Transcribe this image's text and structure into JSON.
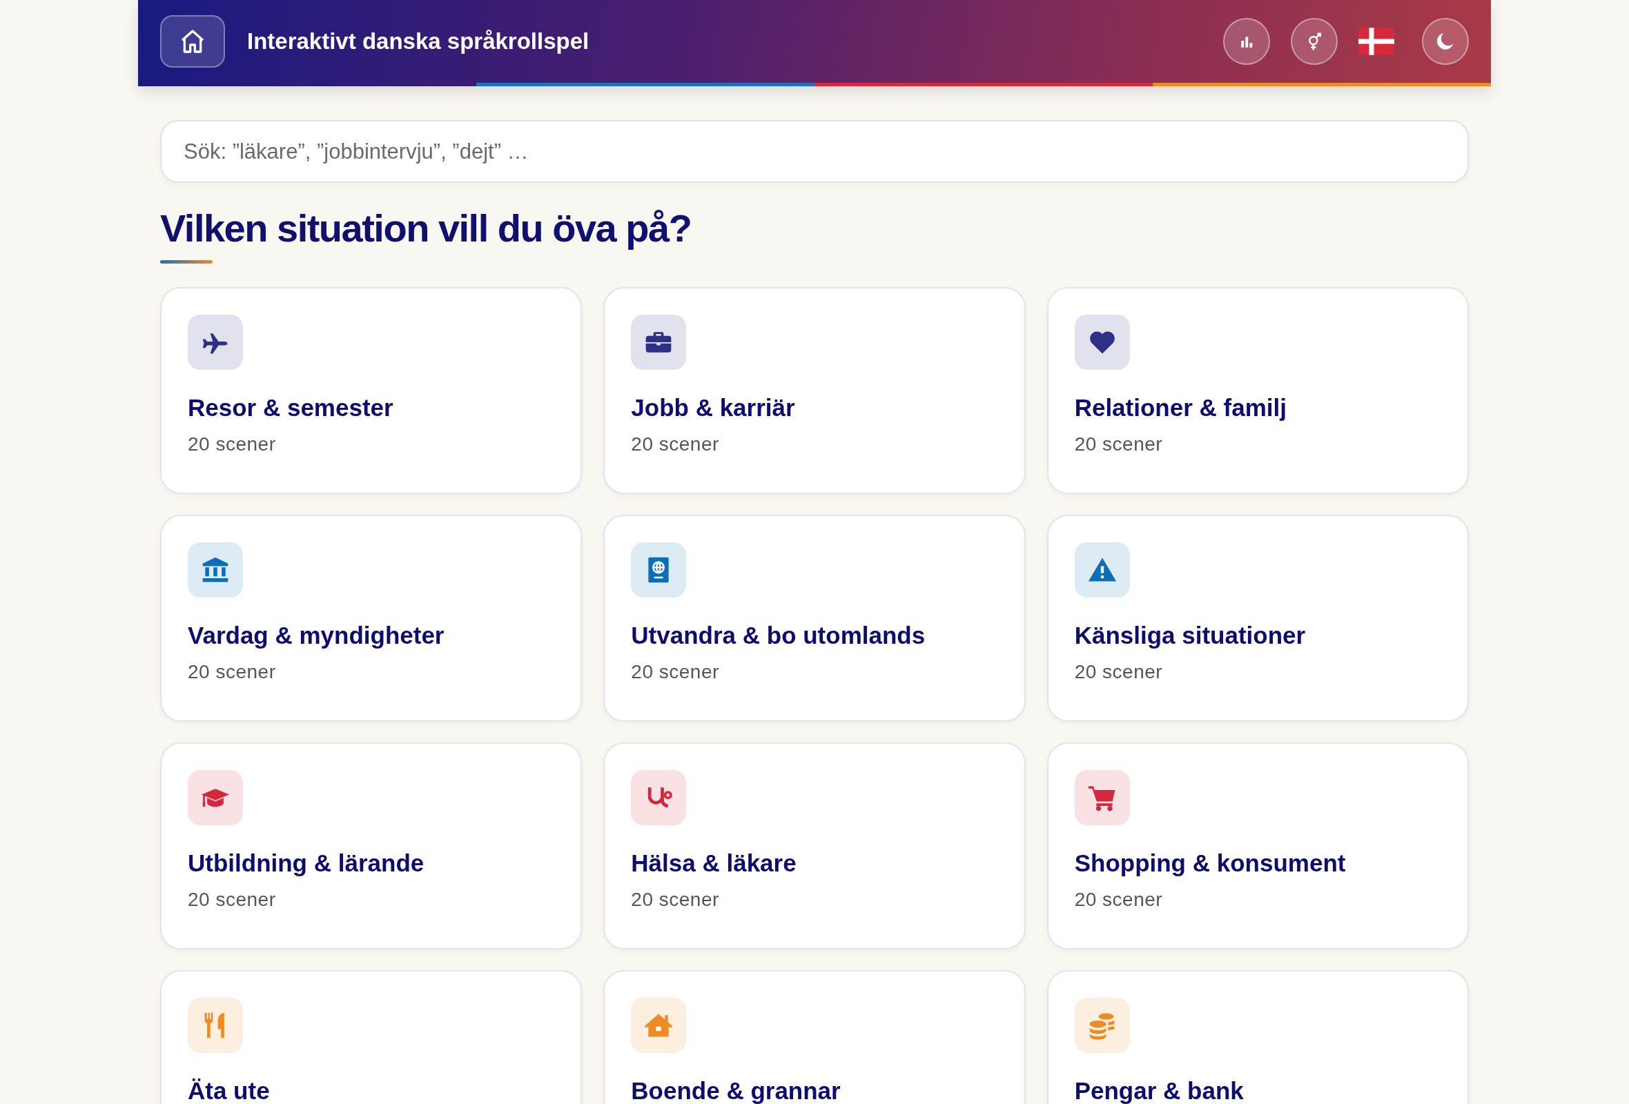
{
  "header": {
    "title": "Interaktivt danska språkrollspel"
  },
  "search": {
    "placeholder": "Sök: ”läkare”, ”jobbintervju”, ”dejt” …"
  },
  "heading": "Vilken situation vill du öva på?",
  "categories": [
    {
      "title": "Resor & semester",
      "count": "20 scener",
      "color": "#2e2f86"
    },
    {
      "title": "Jobb & karriär",
      "count": "20 scener",
      "color": "#2e2f86"
    },
    {
      "title": "Relationer & familj",
      "count": "20 scener",
      "color": "#2e2f86"
    },
    {
      "title": "Vardag & myndigheter",
      "count": "20 scener",
      "color": "#0b6fb8"
    },
    {
      "title": "Utvandra & bo utomlands",
      "count": "20 scener",
      "color": "#0b6fb8"
    },
    {
      "title": "Känsliga situationer",
      "count": "20 scener",
      "color": "#0b6fb8"
    },
    {
      "title": "Utbildning & lärande",
      "count": "20 scener",
      "color": "#d4283c"
    },
    {
      "title": "Hälsa & läkare",
      "count": "20 scener",
      "color": "#d4283c"
    },
    {
      "title": "Shopping & konsument",
      "count": "20 scener",
      "color": "#d4283c"
    },
    {
      "title": "Äta ute",
      "color": "#ee8a22"
    },
    {
      "title": "Boende & grannar",
      "color": "#ee8a22"
    },
    {
      "title": "Pengar & bank",
      "color": "#ee8a22"
    }
  ]
}
